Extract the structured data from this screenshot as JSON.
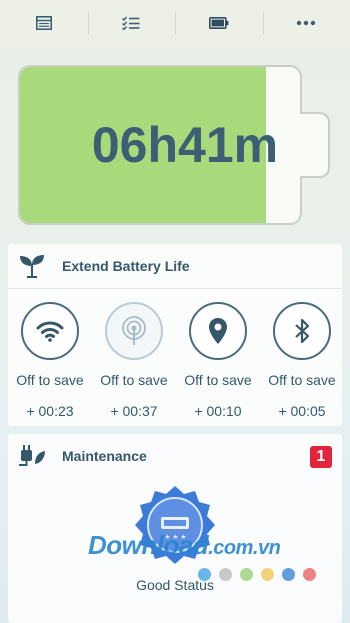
{
  "tabs": [
    {
      "name": "list-icon"
    },
    {
      "name": "checklist-icon"
    },
    {
      "name": "battery-icon",
      "active": true
    },
    {
      "name": "more-icon"
    }
  ],
  "battery": {
    "time_remaining": "06h41m",
    "charge_level": 0.88,
    "fill_color": "#a8d97a"
  },
  "extend": {
    "title": "Extend Battery Life",
    "icon": "leaf-icon",
    "items": [
      {
        "icon": "wifi-icon",
        "label": "Off to save",
        "gain": "+ 00:23"
      },
      {
        "icon": "hotspot-icon",
        "label": "Off to save",
        "gain": "+ 00:37"
      },
      {
        "icon": "location-pin-icon",
        "label": "Off to save",
        "gain": "+ 00:10"
      },
      {
        "icon": "bluetooth-icon",
        "label": "Off to save",
        "gain": "+ 00:05"
      }
    ]
  },
  "maintenance": {
    "title": "Maintenance",
    "icon": "plug-icon",
    "badge": "1",
    "status": "Good Status",
    "watermark": "Download",
    "watermark_domain": ".com.vn",
    "dot_colors": [
      "#3a9fe0",
      "#b7b7b7",
      "#8fd06b",
      "#f2c14f",
      "#2f7fd0",
      "#e65a5a"
    ]
  },
  "colors": {
    "accent": "#35576a",
    "badge": "#e3253b"
  }
}
